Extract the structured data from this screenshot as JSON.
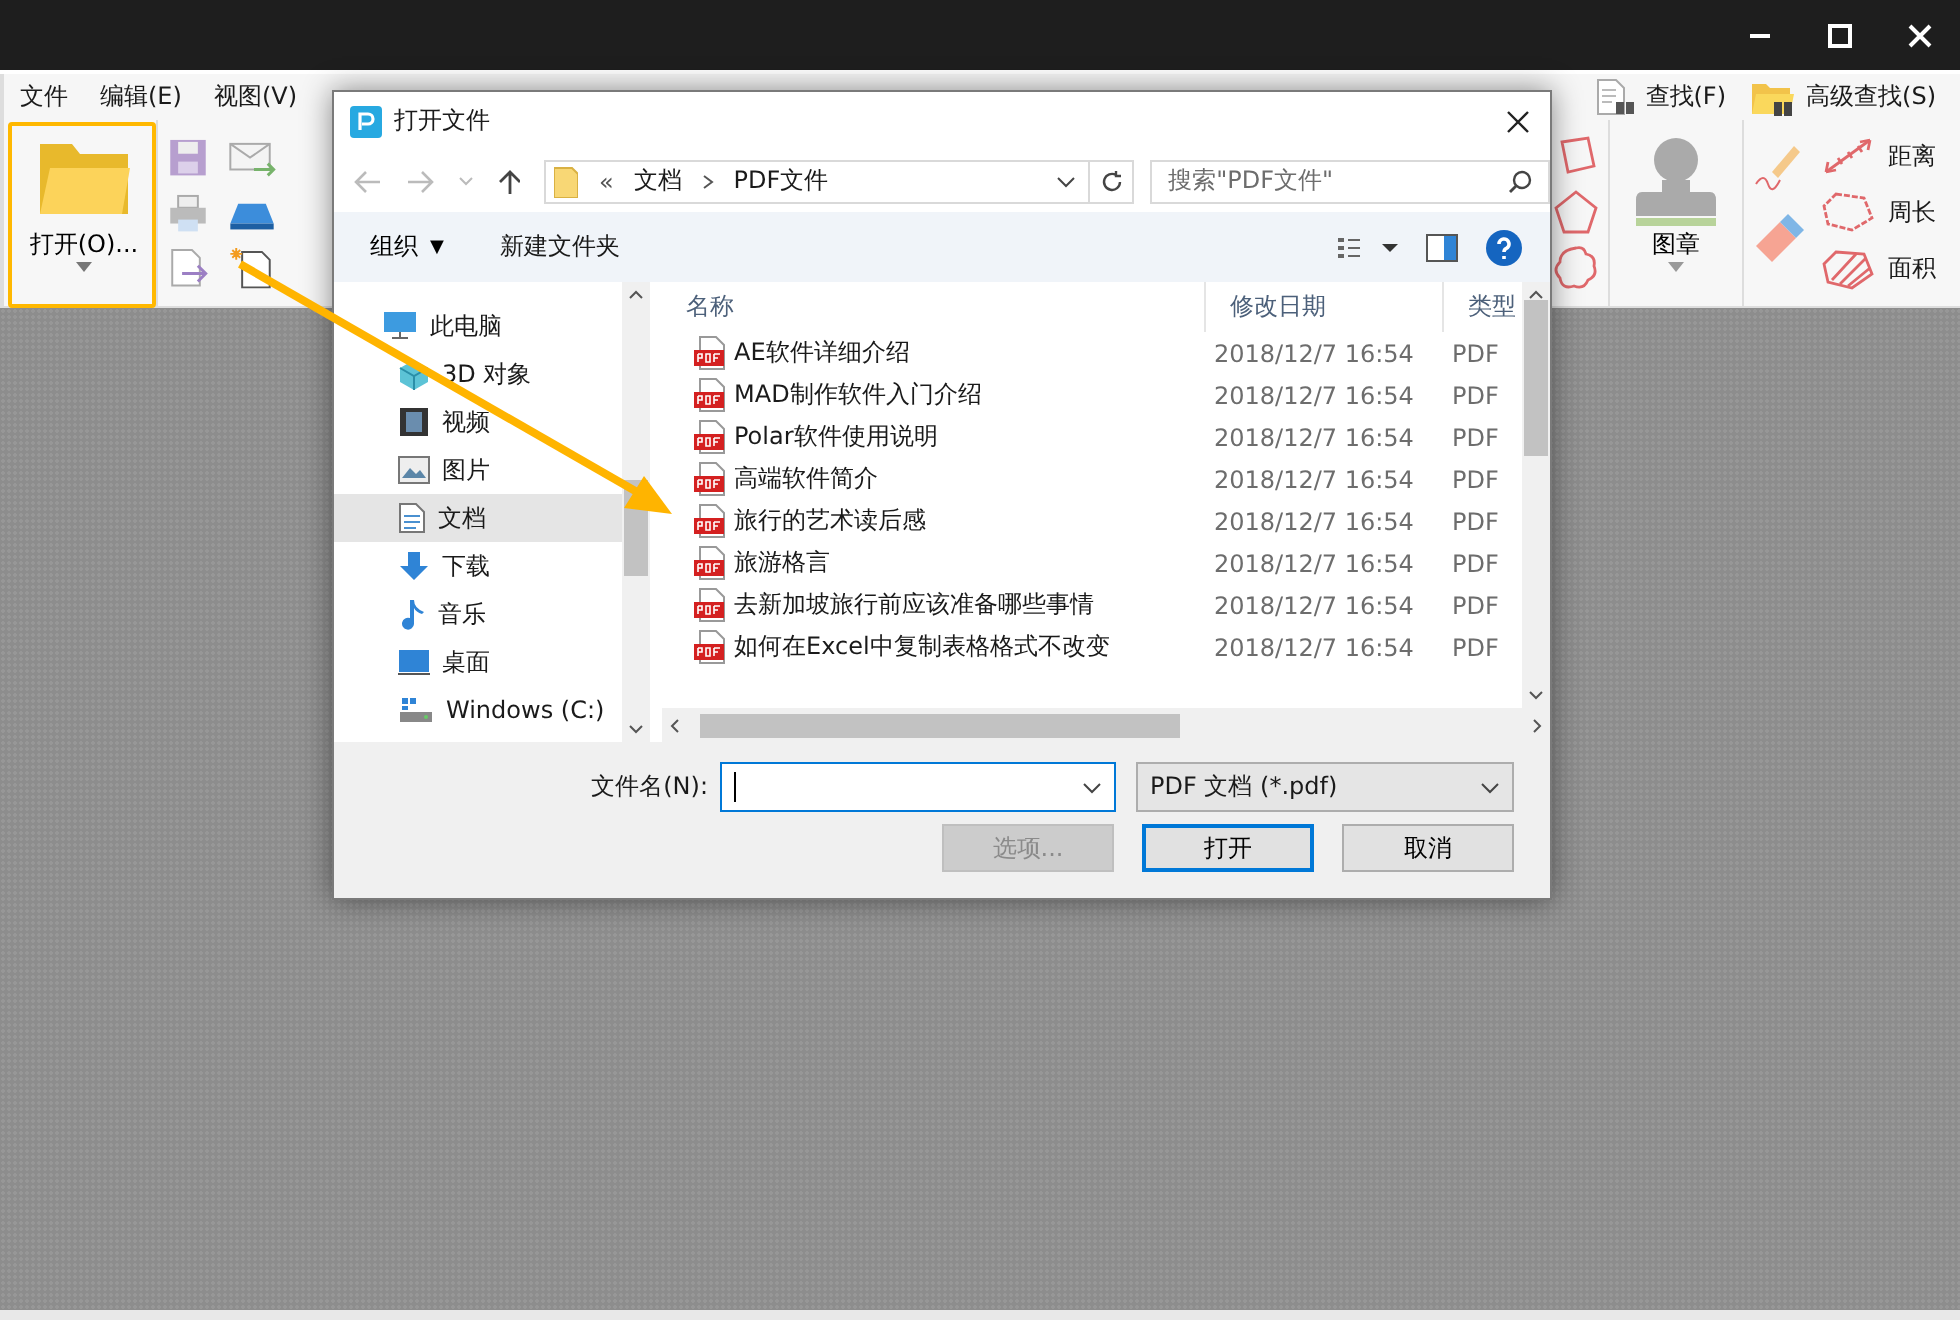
{
  "app": {
    "menu": [
      {
        "label": "文件"
      },
      {
        "label": "编辑(E)"
      },
      {
        "label": "视图(V)"
      }
    ],
    "find_tools": [
      {
        "kind": "find",
        "label": "查找(F)"
      },
      {
        "kind": "advanced",
        "label": "高级查找(S)"
      }
    ],
    "open_button": {
      "label": "打开(O)..."
    },
    "stamp_button": {
      "label": "图章"
    },
    "measure_tools": [
      {
        "kind": "distance",
        "label": "距离"
      },
      {
        "kind": "perimeter",
        "label": "周长"
      },
      {
        "kind": "area",
        "label": "面积"
      }
    ]
  },
  "dialog": {
    "title": "打开文件",
    "breadcrumb_overflow": "«",
    "breadcrumb": [
      {
        "label": "文档"
      },
      {
        "label": "PDF文件"
      }
    ],
    "search": {
      "placeholder": "搜索\"PDF文件\""
    },
    "organize": {
      "label": "组织",
      "caret": "▼"
    },
    "new_folder": {
      "label": "新建文件夹"
    },
    "nav": [
      {
        "kind": "computer",
        "label": "此电脑",
        "selected": false,
        "children": [
          {
            "kind": "objects3d",
            "label": "3D 对象",
            "selected": false
          },
          {
            "kind": "video",
            "label": "视频",
            "selected": false
          },
          {
            "kind": "pictures",
            "label": "图片",
            "selected": false
          },
          {
            "kind": "documents",
            "label": "文档",
            "selected": true
          },
          {
            "kind": "downloads",
            "label": "下载",
            "selected": false
          },
          {
            "kind": "music",
            "label": "音乐",
            "selected": false
          },
          {
            "kind": "desktop",
            "label": "桌面",
            "selected": false
          },
          {
            "kind": "drive",
            "label": "Windows (C:)",
            "selected": false
          }
        ]
      }
    ],
    "columns": [
      {
        "label": "名称"
      },
      {
        "label": "修改日期"
      },
      {
        "label": "类型"
      }
    ],
    "rows": [
      {
        "name": "AE软件详细介绍",
        "modified": "2018/12/7 16:54",
        "type": "PDF"
      },
      {
        "name": "MAD制作软件入门介绍",
        "modified": "2018/12/7 16:54",
        "type": "PDF"
      },
      {
        "name": "Polar软件使用说明",
        "modified": "2018/12/7 16:54",
        "type": "PDF"
      },
      {
        "name": "高端软件简介",
        "modified": "2018/12/7 16:54",
        "type": "PDF"
      },
      {
        "name": "旅行的艺术读后感",
        "modified": "2018/12/7 16:54",
        "type": "PDF"
      },
      {
        "name": "旅游格言",
        "modified": "2018/12/7 16:54",
        "type": "PDF"
      },
      {
        "name": "去新加坡旅行前应该准备哪些事情",
        "modified": "2018/12/7 16:54",
        "type": "PDF"
      },
      {
        "name": "如何在Excel中复制表格格式不改变",
        "modified": "2018/12/7 16:54",
        "type": "PDF"
      }
    ],
    "filename": {
      "label": "文件名(N):"
    },
    "filter": {
      "value": "PDF 文档 (*.pdf)"
    },
    "buttons": [
      {
        "label": "选项...",
        "disabled": true,
        "default": false
      },
      {
        "label": "打开",
        "disabled": false,
        "default": true
      },
      {
        "label": "取消",
        "disabled": false,
        "default": false
      }
    ]
  }
}
